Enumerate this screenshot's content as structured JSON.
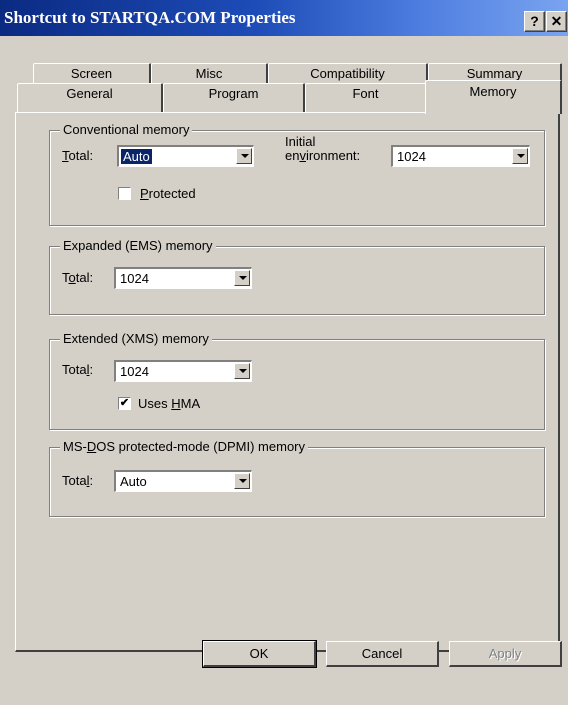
{
  "window": {
    "title": "Shortcut to STARTQA.COM Properties",
    "help_button": "?",
    "close_button": "✕"
  },
  "tabs": {
    "row1": [
      "Screen",
      "Misc",
      "Compatibility",
      "Summary"
    ],
    "row2": [
      "General",
      "Program",
      "Font",
      "Memory"
    ],
    "active": "Memory"
  },
  "conventional": {
    "label": "Conventional memory",
    "total_label_u": "T",
    "total_label_rest": "otal:",
    "total_value": "Auto",
    "initial_label_line1": "Initial",
    "initial_label_pre": "en",
    "initial_label_u": "v",
    "initial_label_post": "ironment:",
    "initial_value": "1024",
    "protected_u": "P",
    "protected_rest": "rotected",
    "protected_checked": false
  },
  "expanded": {
    "label": "Expanded (EMS) memory",
    "total_pre": "T",
    "total_u": "o",
    "total_post": "tal:",
    "total_value": "1024"
  },
  "extended": {
    "label": "Extended (XMS) memory",
    "total_pre": "Tota",
    "total_u": "l",
    "total_post": ":",
    "total_value": "1024",
    "hma_pre": "Uses ",
    "hma_u": "H",
    "hma_post": "MA",
    "hma_checked": true
  },
  "dpmi": {
    "label_pre": "MS-",
    "label_u": "D",
    "label_post": "OS protected-mode (DPMI) memory",
    "total_pre": "Tota",
    "total_u": "l",
    "total_post": ":",
    "total_value": "Auto"
  },
  "buttons": {
    "ok": "OK",
    "cancel": "Cancel",
    "apply": "Apply"
  },
  "colors": {
    "titlebar_start": "#0b2a82",
    "face": "#d4d0c8",
    "selection": "#0a246a"
  }
}
